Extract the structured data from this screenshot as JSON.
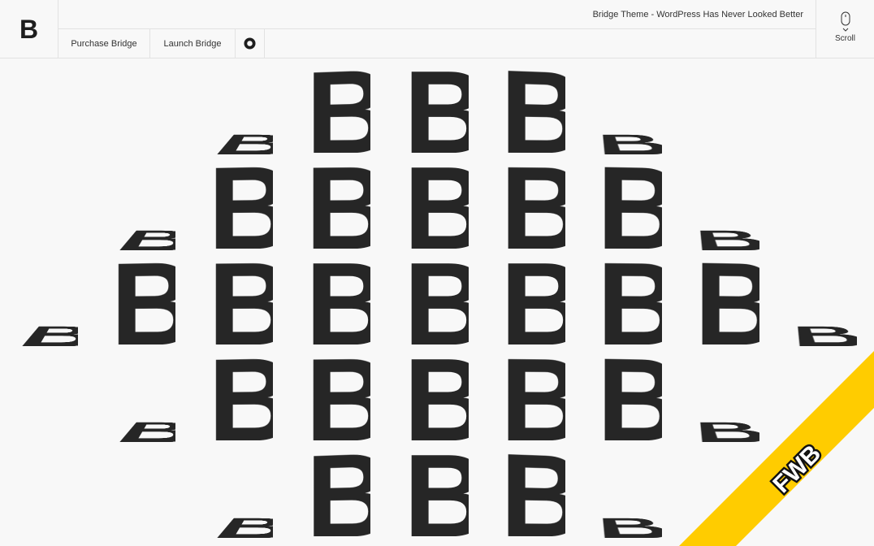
{
  "header": {
    "logo_letter": "B",
    "tagline": "Bridge Theme - WordPress Has Never Looked Better",
    "nav": {
      "purchase_label": "Purchase Bridge",
      "launch_label": "Launch Bridge",
      "circle_icon": "ring-icon"
    },
    "scroll": {
      "icon": "mouse-icon",
      "label": "Scroll"
    }
  },
  "hero": {
    "glyph": "B",
    "color": "#262626"
  },
  "ribbon": {
    "text": "FWB",
    "color": "#ffcc00"
  }
}
